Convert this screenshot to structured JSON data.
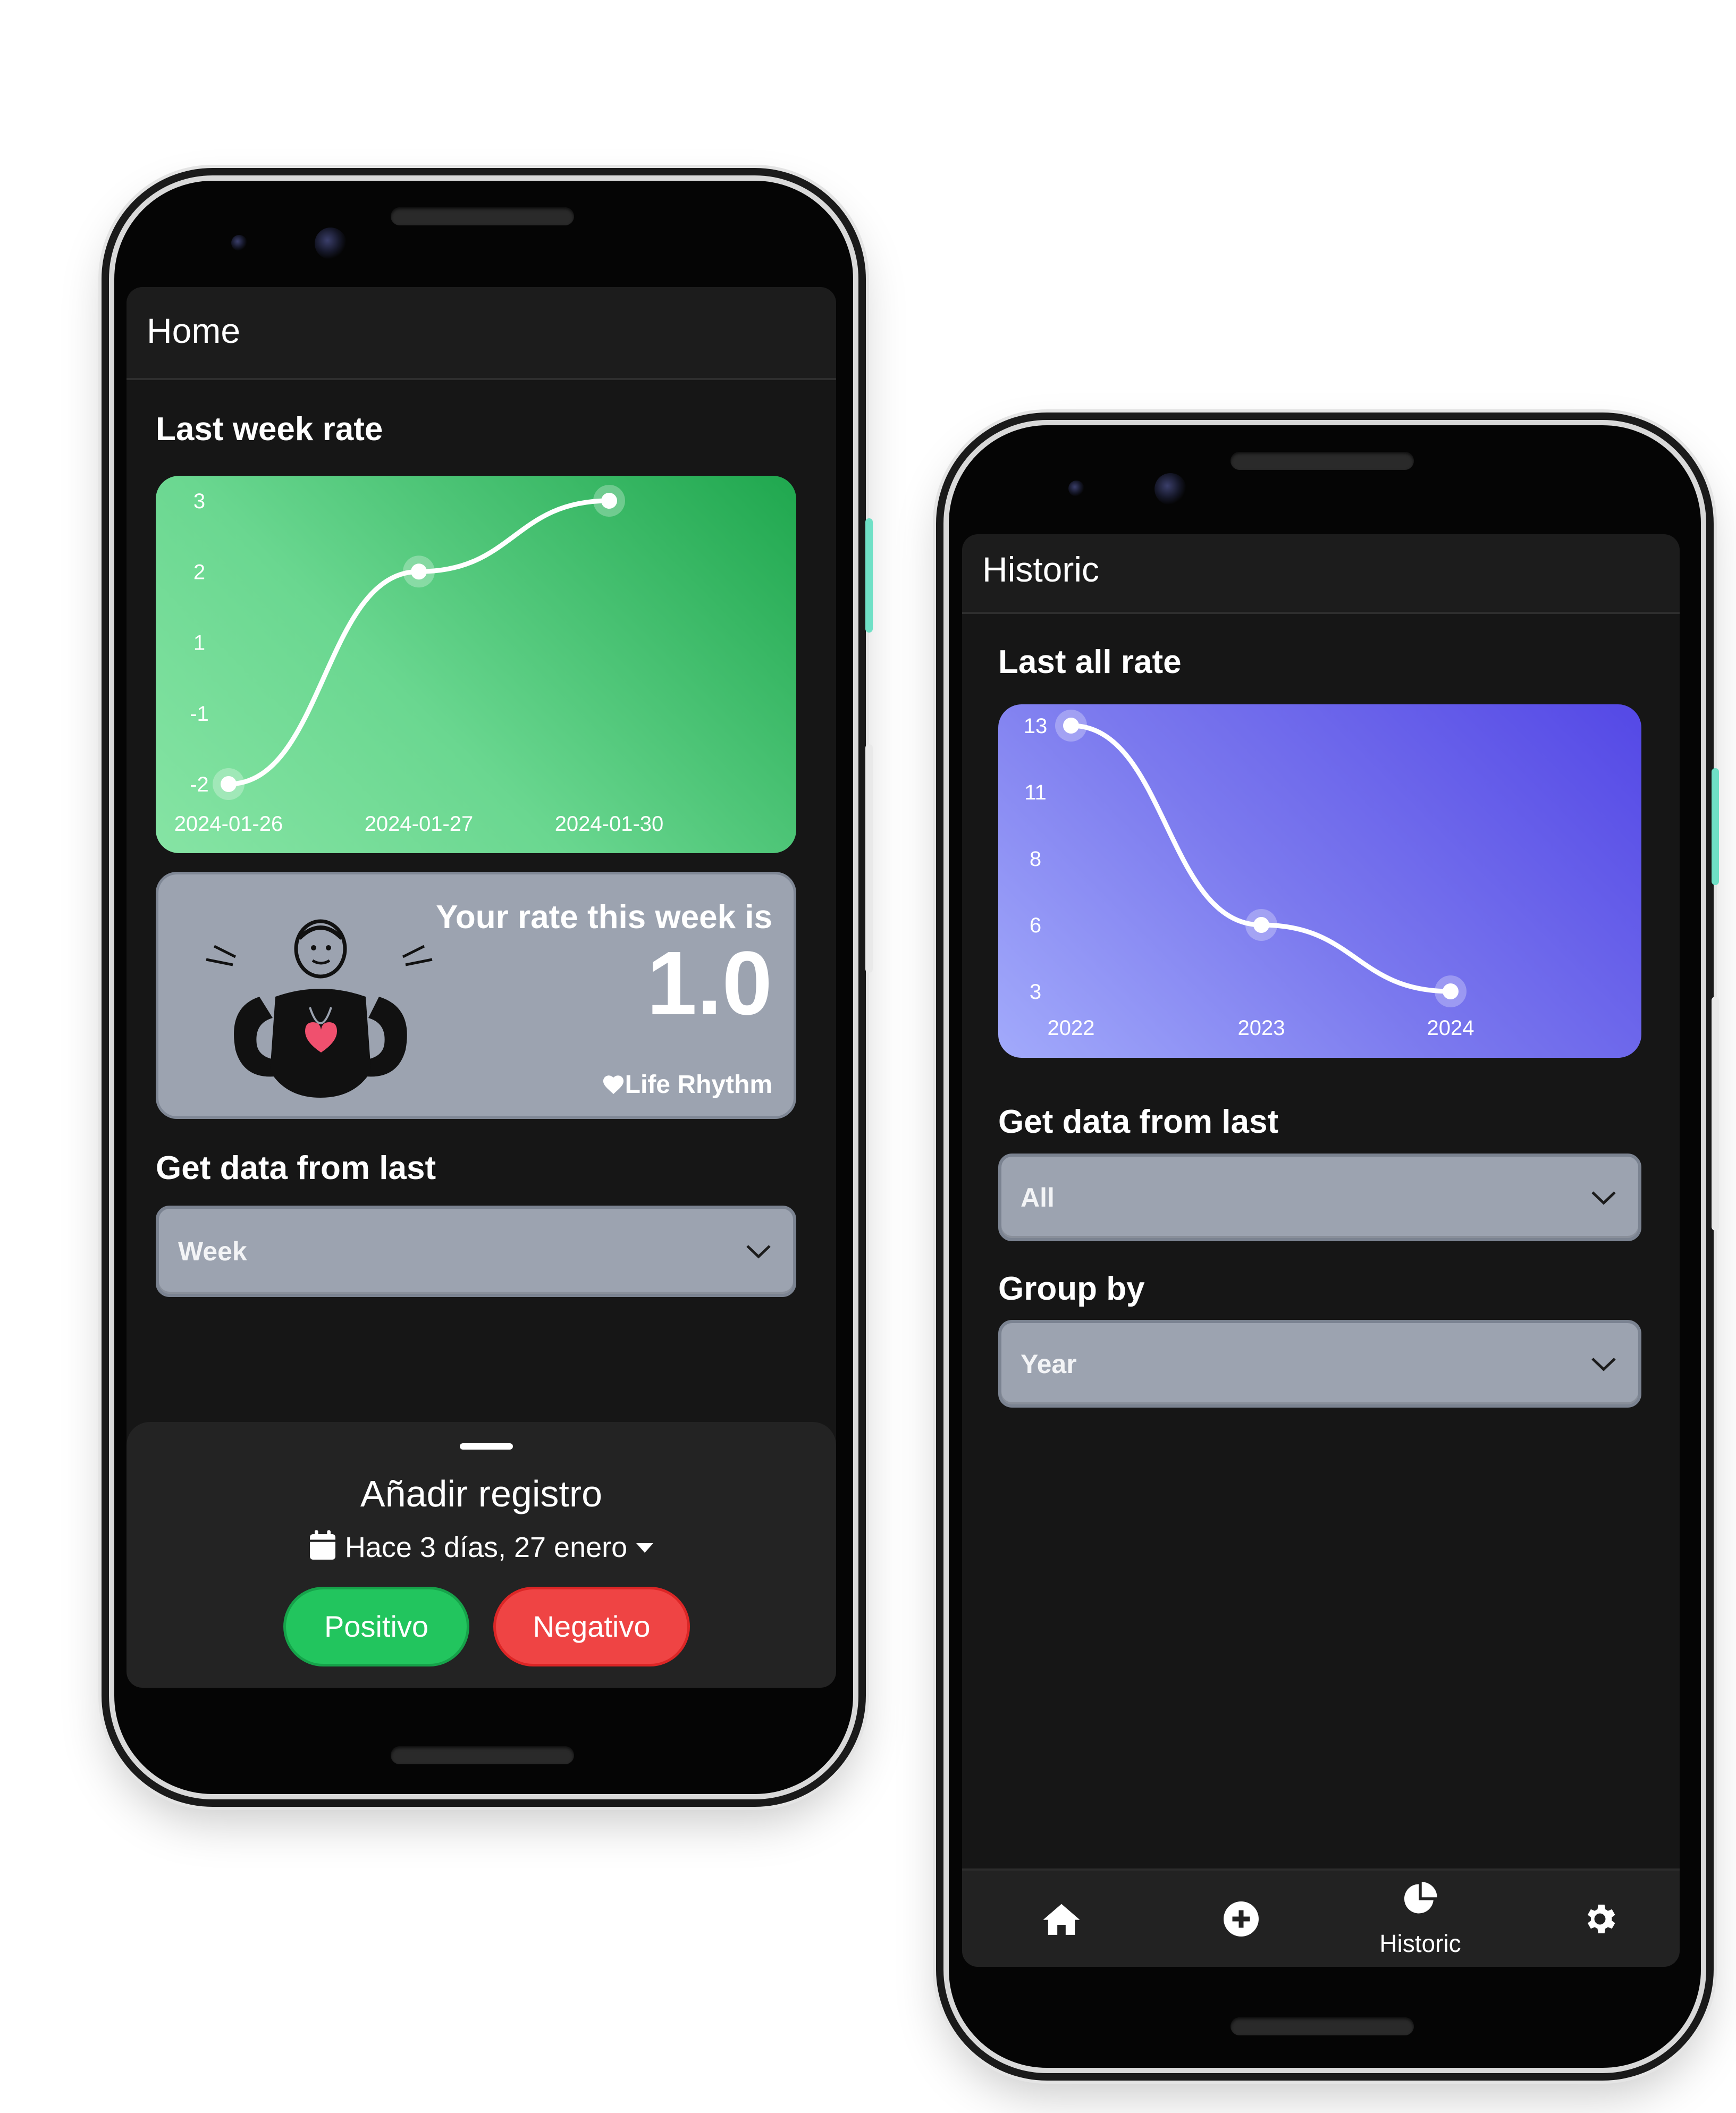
{
  "home": {
    "title": "Home",
    "chart_section_label": "Last week rate",
    "rate_card": {
      "heading": "Your rate this week is",
      "value": "1.0",
      "brand": "Life Rhythm",
      "brand_icon": "heart-icon",
      "illustration": "person-holding-heart"
    },
    "filter_label": "Get data from last",
    "filter_select": {
      "value": "Week",
      "icon": "chevron-down-icon"
    },
    "sheet": {
      "title": "Añadir registro",
      "date_icon": "calendar-icon",
      "date_text": "Hace 3 días, 27 enero",
      "date_caret_icon": "caret-down-icon",
      "positive_label": "Positivo",
      "negative_label": "Negativo"
    }
  },
  "historic": {
    "title": "Historic",
    "chart_section_label": "Last all rate",
    "filter_label": "Get data from last",
    "filter_select": {
      "value": "All",
      "icon": "chevron-down-icon"
    },
    "group_label": "Group by",
    "group_select": {
      "value": "Year",
      "icon": "chevron-down-icon"
    },
    "nav": {
      "items": [
        {
          "icon": "home-icon",
          "label": ""
        },
        {
          "icon": "add-circle-icon",
          "label": ""
        },
        {
          "icon": "pie-chart-icon",
          "label": "Historic",
          "active": true
        },
        {
          "icon": "settings-icon",
          "label": ""
        }
      ]
    }
  },
  "colors": {
    "screen_bg": "#161616",
    "green_chart_from": "#86e4a4",
    "green_chart_to": "#1fa74e",
    "purple_chart_from": "#a2aafb",
    "purple_chart_to": "#5448e6",
    "positive": "#22c55e",
    "negative": "#ef4444",
    "card_gray": "#9ca3b0"
  },
  "chart_data": [
    {
      "type": "line",
      "title": "Last week rate",
      "categories": [
        "2024-01-26",
        "2024-01-27",
        "2024-01-30"
      ],
      "y_ticks": [
        "3",
        "2",
        "1",
        "-1",
        "-2"
      ],
      "values": [
        -2,
        2,
        3
      ],
      "grid": false,
      "smooth": true
    },
    {
      "type": "line",
      "title": "Last all rate",
      "categories": [
        "2022",
        "2023",
        "2024"
      ],
      "y_ticks": [
        "13",
        "11",
        "8",
        "6",
        "3"
      ],
      "values": [
        13,
        6,
        3
      ],
      "grid": false,
      "smooth": true
    }
  ]
}
